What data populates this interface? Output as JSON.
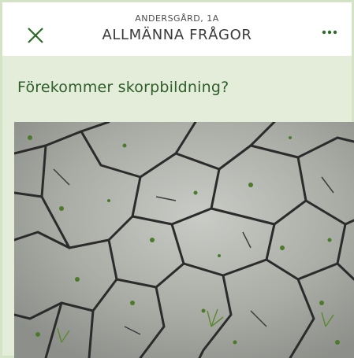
{
  "header": {
    "subtitle": "ANDERSGÅRD, 1A",
    "title": "ALLMÄNNA FRÅGOR",
    "close_icon": "close-icon",
    "more_icon": "more-dots-icon"
  },
  "question": {
    "text": "Förekommer skorpbildning?"
  },
  "colors": {
    "accent_green": "#2e6b2a",
    "panel_green": "#e4edd9",
    "header_bg": "#ffffff"
  }
}
